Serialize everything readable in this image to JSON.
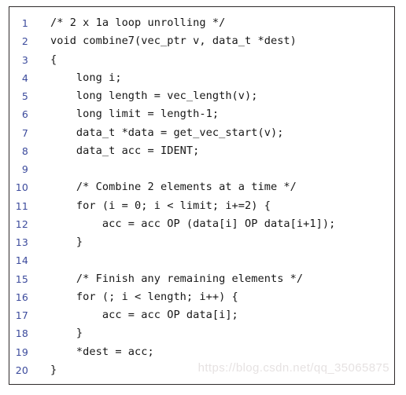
{
  "listing": {
    "language": "c",
    "title": "2 x 1a loop unrolling code listing",
    "border_color": "#2e2a2b",
    "background_color": "#ffffff",
    "line_number_color": "#3b4a9c",
    "code_color": "#171717",
    "lines": [
      {
        "number": "1",
        "code": "/* 2 x 1a loop unrolling */"
      },
      {
        "number": "2",
        "code": "void combine7(vec_ptr v, data_t *dest)"
      },
      {
        "number": "3",
        "code": "{"
      },
      {
        "number": "4",
        "code": "    long i;"
      },
      {
        "number": "5",
        "code": "    long length = vec_length(v);"
      },
      {
        "number": "6",
        "code": "    long limit = length-1;"
      },
      {
        "number": "7",
        "code": "    data_t *data = get_vec_start(v);"
      },
      {
        "number": "8",
        "code": "    data_t acc = IDENT;"
      },
      {
        "number": "9",
        "code": ""
      },
      {
        "number": "10",
        "code": "    /* Combine 2 elements at a time */"
      },
      {
        "number": "11",
        "code": "    for (i = 0; i < limit; i+=2) {"
      },
      {
        "number": "12",
        "code": "        acc = acc OP (data[i] OP data[i+1]);"
      },
      {
        "number": "13",
        "code": "    }"
      },
      {
        "number": "14",
        "code": ""
      },
      {
        "number": "15",
        "code": "    /* Finish any remaining elements */"
      },
      {
        "number": "16",
        "code": "    for (; i < length; i++) {"
      },
      {
        "number": "17",
        "code": "        acc = acc OP data[i];"
      },
      {
        "number": "18",
        "code": "    }"
      },
      {
        "number": "19",
        "code": "    *dest = acc;"
      },
      {
        "number": "20",
        "code": "}"
      }
    ]
  },
  "watermark": {
    "text": "https://blog.csdn.net/qq_35065875",
    "color": "#e6e2e2"
  }
}
